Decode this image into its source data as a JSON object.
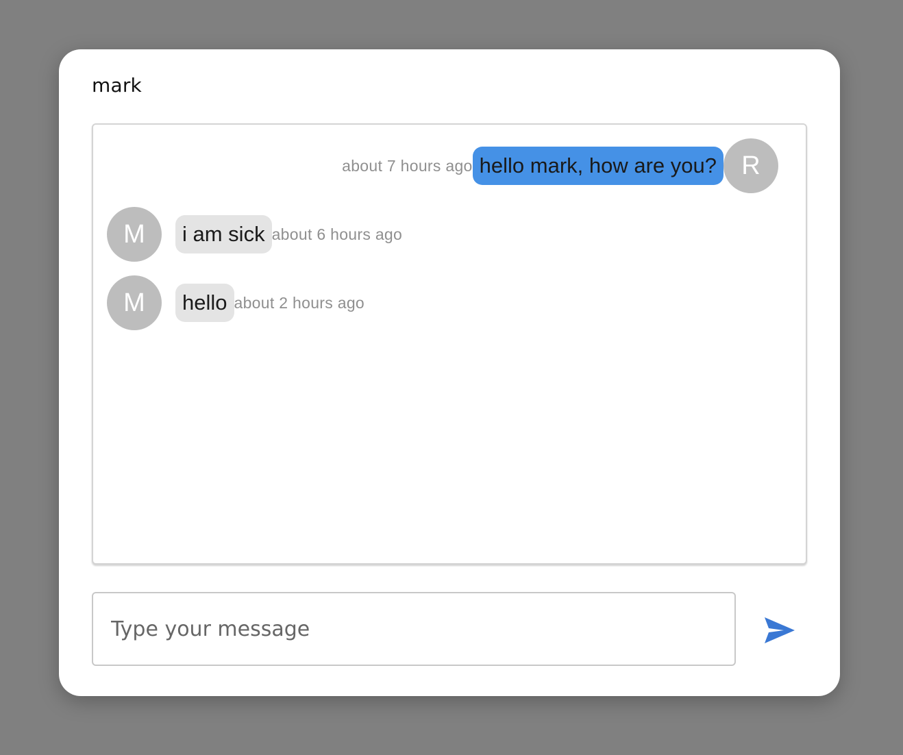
{
  "chat": {
    "title": "mark",
    "accent_color": "#4591e6",
    "messages": [
      {
        "direction": "outgoing",
        "avatar_initial": "R",
        "text": "hello mark, how are you?",
        "time": "about 7 hours ago"
      },
      {
        "direction": "incoming",
        "avatar_initial": "M",
        "text": "i am sick",
        "time": "about 6 hours ago"
      },
      {
        "direction": "incoming",
        "avatar_initial": "M",
        "text": "hello",
        "time": "about 2 hours ago"
      }
    ]
  },
  "composer": {
    "placeholder": "Type your message",
    "value": "",
    "send_icon": "send-icon"
  }
}
